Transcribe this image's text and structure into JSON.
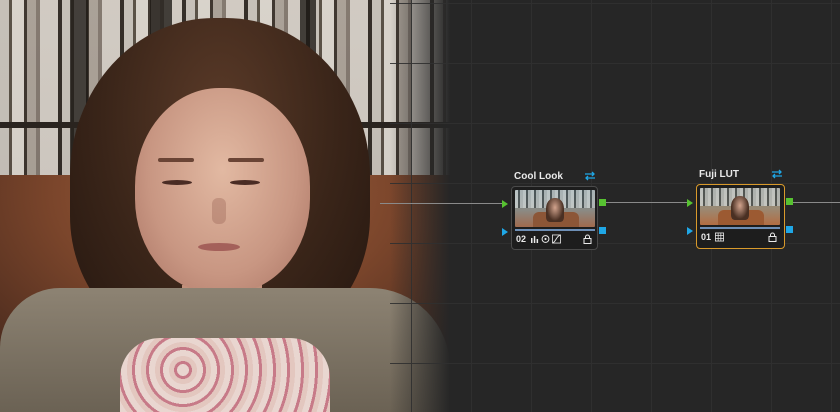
{
  "nodes": [
    {
      "title": "Cool Look",
      "number": "02",
      "tools": [
        "bars-icon",
        "circle-target-icon",
        "curve-icon"
      ],
      "selected": false
    },
    {
      "title": "Fuji LUT",
      "number": "01",
      "tools": [
        "lut-grid-icon"
      ],
      "selected": true
    }
  ],
  "colors": {
    "accent_selected": "#d99a2b",
    "rgb_port": "#57c231",
    "key_port": "#1fa7e6",
    "wire": "#8a8a8a",
    "background": "#262626"
  }
}
